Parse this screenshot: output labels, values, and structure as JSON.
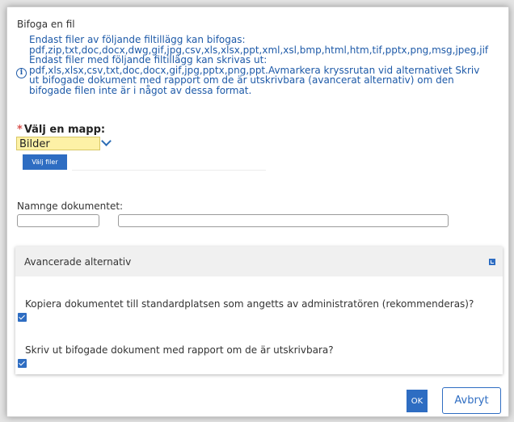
{
  "dialog": {
    "title": "Bifoga en fil"
  },
  "info": {
    "icon": "info-icon",
    "lines": [
      "Endast filer av följande filtillägg kan bifogas:",
      "pdf,zip,txt,doc,docx,dwg,gif,jpg,csv,xls,xlsx,ppt,xml,xsl,bmp,html,htm,tif,pptx,png,msg,jpeg,jif",
      "Endast filer med följande filtillägg kan skrivas ut:",
      "pdf,xls,xlsx,csv,txt,doc,docx,gif,jpg,pptx,png,ppt.Avmarkera kryssrutan vid alternativet Skriv",
      "ut bifogade dokument med rapport om de är utskrivbara (avancerat alternativ) om den",
      "bifogade filen inte är i något av dessa format."
    ]
  },
  "folder": {
    "required_mark": "*",
    "label": "Välj en mapp:",
    "selected": "Bilder"
  },
  "choose_files_label": "Välj filer",
  "name_label": "Namnge dokumentet:",
  "advanced": {
    "title": "Avancerade alternativ",
    "options": [
      {
        "label": "Kopiera dokumentet till standardplatsen som angetts av administratören (rekommenderas)?",
        "checked": true
      },
      {
        "label": "Skriv ut bifogade dokument med rapport om de är utskrivbara?",
        "checked": true
      }
    ]
  },
  "buttons": {
    "ok": "OK",
    "cancel": "Avbryt"
  },
  "colors": {
    "accent": "#2e6dc2",
    "info_text": "#1e5aa8",
    "select_bg": "#fdf1a6"
  }
}
